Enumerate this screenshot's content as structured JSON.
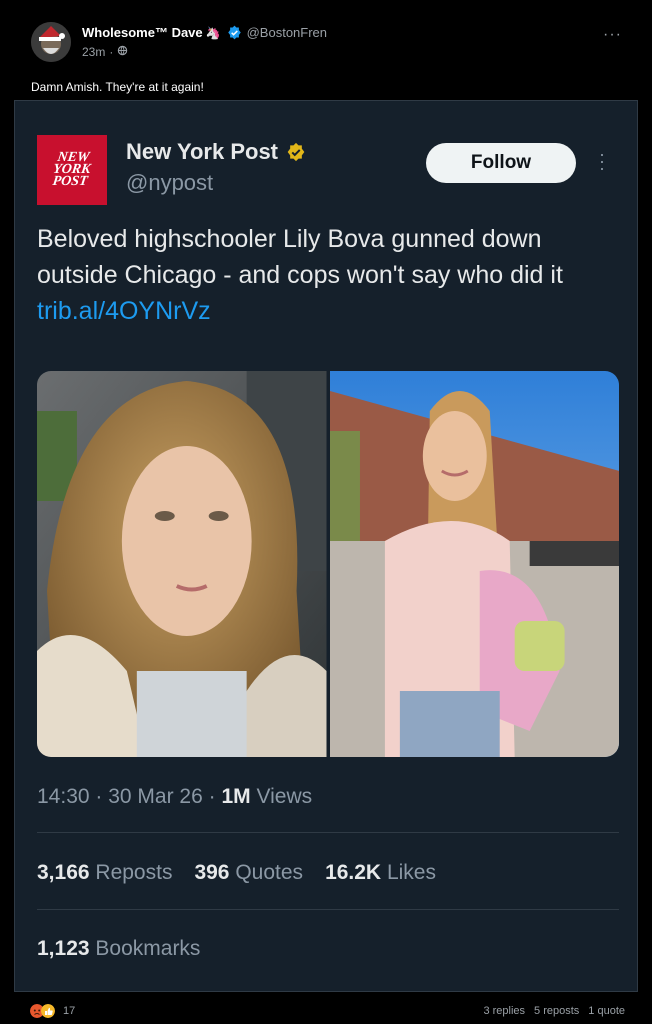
{
  "outer_post": {
    "author_name": "Wholesome™ Dave",
    "handle": "@BostonFren",
    "time": "23m",
    "text": "Damn Amish. They're at it again!",
    "more_icon": "more-dots-icon"
  },
  "tweet": {
    "logo_text": "NEW YORK POST",
    "display_name": "New York Post",
    "handle": "@nypost",
    "follow_label": "Follow",
    "body_text": "Beloved highschooler Lily Bova gunned down outside Chicago - and cops won't say who did it ",
    "link_text": "trib.al/4OYNrVz",
    "time": "14:30",
    "date": "30 Mar 26",
    "views_count": "1M",
    "views_label": "Views",
    "reposts_count": "3,166",
    "reposts_label": "Reposts",
    "quotes_count": "396",
    "quotes_label": "Quotes",
    "likes_count": "16.2K",
    "likes_label": "Likes",
    "bookmarks_count": "1,123",
    "bookmarks_label": "Bookmarks"
  },
  "footer": {
    "reaction_count": "17",
    "replies": "3 replies",
    "reposts": "5 reposts",
    "quotes": "1 quote"
  },
  "colors": {
    "card_bg": "#15202b",
    "link": "#1d9bf0",
    "brand_red": "#c8102e",
    "verified_blue": "#1d9bf0",
    "verified_gold": "#e2b719"
  }
}
